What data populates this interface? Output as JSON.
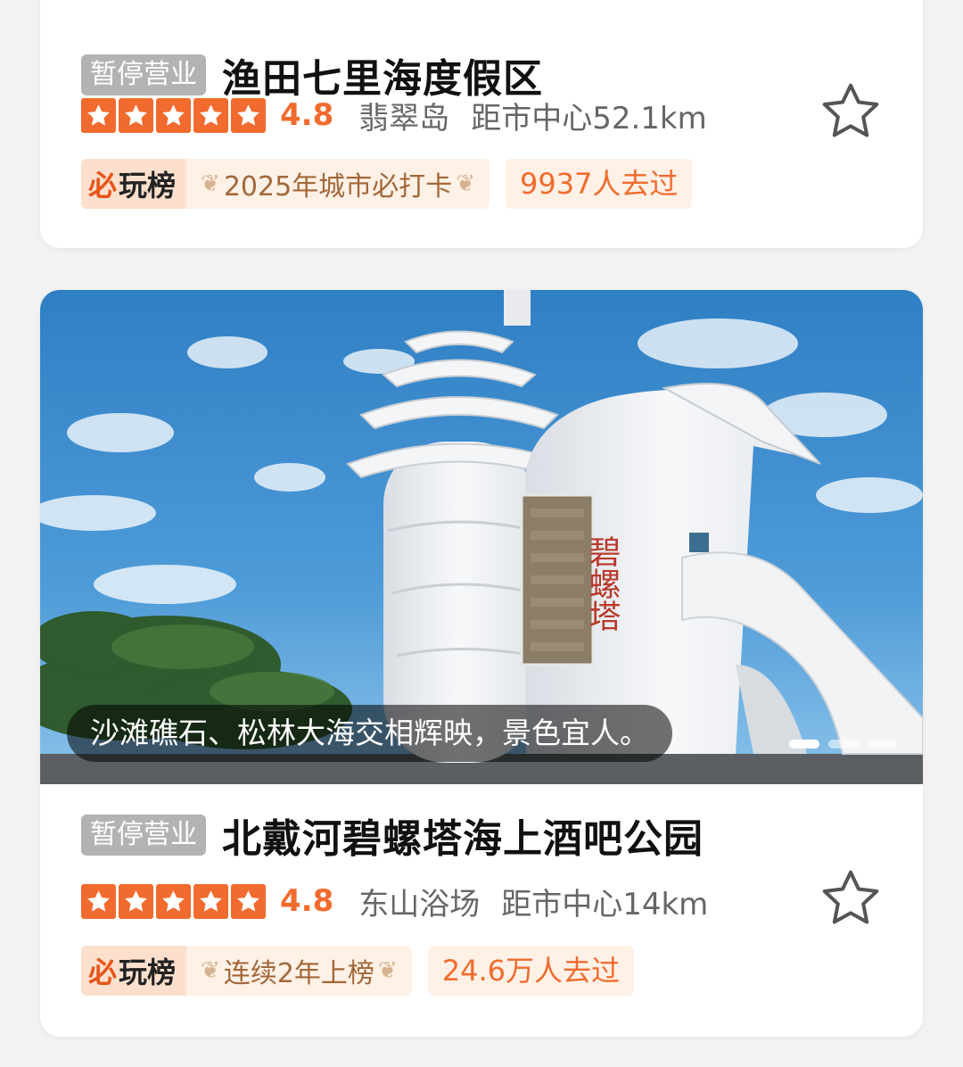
{
  "listings": [
    {
      "status": "暂停营业",
      "title": "渔田七里海度假区",
      "rating": 4.8,
      "rating_text": "4.8",
      "stars": 5,
      "area": "翡翠岛",
      "distance": "距市中心52.1km",
      "rank_logo": "玩榜",
      "rank_logo_mark": "必",
      "rank_label": "2025年城市必打卡",
      "visited": "9937人去过"
    },
    {
      "status": "暂停营业",
      "title": "北戴河碧螺塔海上酒吧公园",
      "rating": 4.8,
      "rating_text": "4.8",
      "stars": 5,
      "area": "东山浴场",
      "distance": "距市中心14km",
      "rank_logo": "玩榜",
      "rank_logo_mark": "必",
      "rank_label": "连续2年上榜",
      "visited": "24.6万人去过",
      "photo": {
        "caption": "沙滩礁石、松林大海交相辉映，景色宜人。",
        "sign_text": "碧螺塔",
        "carousel_count": 3,
        "carousel_active": 0
      }
    }
  ],
  "colors": {
    "accent": "#f26b2e",
    "status_bg": "#b3b3b3",
    "tag_bg": "#fff1e6",
    "rank_text": "#a2683a",
    "background": "#f2f2f2"
  },
  "icons": {
    "rating_star": "star-filled-icon",
    "favorite": "star-outline-icon",
    "laurel": "laurel-icon"
  }
}
